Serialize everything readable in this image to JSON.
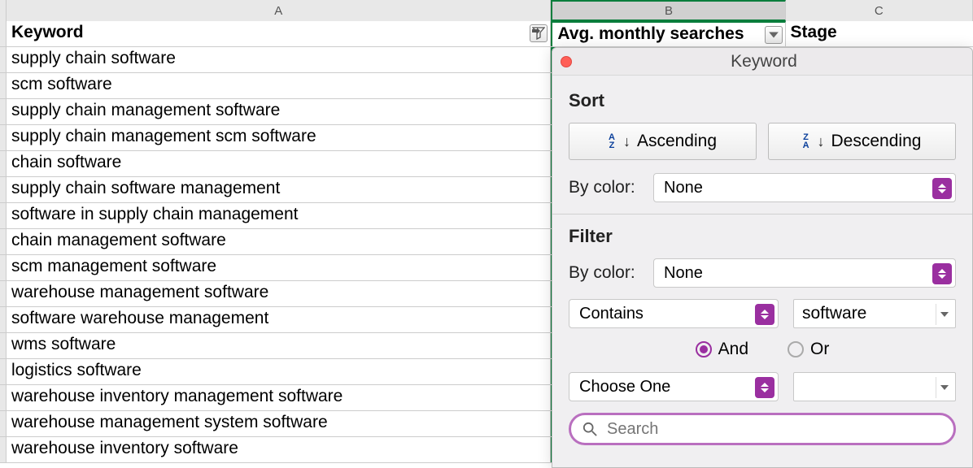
{
  "columns": {
    "a": "A",
    "b": "B",
    "c": "C"
  },
  "headers": {
    "keyword": "Keyword",
    "avg_searches": "Avg. monthly searches",
    "stage": "Stage"
  },
  "rows": [
    "supply chain software",
    "scm software",
    "supply chain management software",
    "supply chain management scm software",
    "chain software",
    "supply chain software management",
    "software in supply chain management",
    "chain management software",
    "scm management software",
    "warehouse management software",
    "software warehouse management",
    "wms software",
    "logistics software",
    "warehouse inventory management software",
    "warehouse management system software",
    "warehouse inventory software"
  ],
  "panel": {
    "title": "Keyword",
    "sort_heading": "Sort",
    "ascending": "Ascending",
    "descending": "Descending",
    "by_color": "By color:",
    "none": "None",
    "filter_heading": "Filter",
    "contains": "Contains",
    "filter_value": "software",
    "and": "And",
    "or": "Or",
    "choose_one": "Choose One",
    "second_value": "",
    "search_placeholder": "Search"
  }
}
